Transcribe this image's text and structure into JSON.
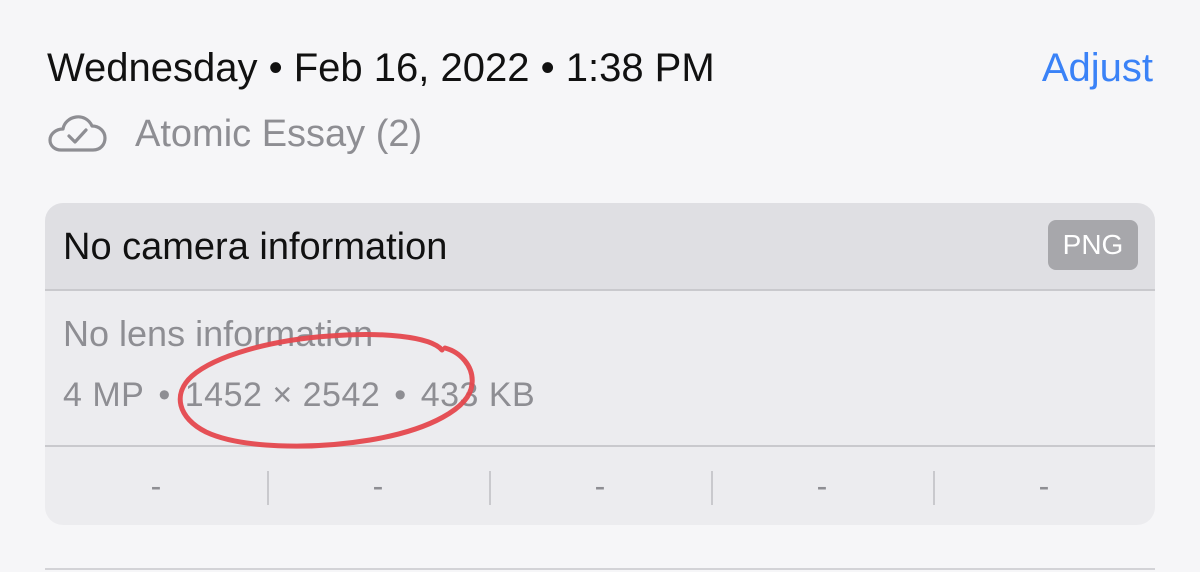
{
  "header": {
    "date_time": "Wednesday • Feb 16, 2022 • 1:38 PM",
    "adjust_label": "Adjust"
  },
  "album": {
    "icon": "cloud-check-icon",
    "name": "Atomic Essay (2)"
  },
  "info_card": {
    "camera": "No camera information",
    "format": "PNG",
    "lens": "No lens information",
    "specs": {
      "megapixels": "4 MP",
      "separator": "•",
      "dimensions": "1452 × 2542",
      "file_size": "433 KB"
    },
    "exif_values": [
      "-",
      "-",
      "-",
      "-",
      "-"
    ]
  },
  "colors": {
    "accent": "#3a82f7",
    "annotation": "#e5484d"
  }
}
